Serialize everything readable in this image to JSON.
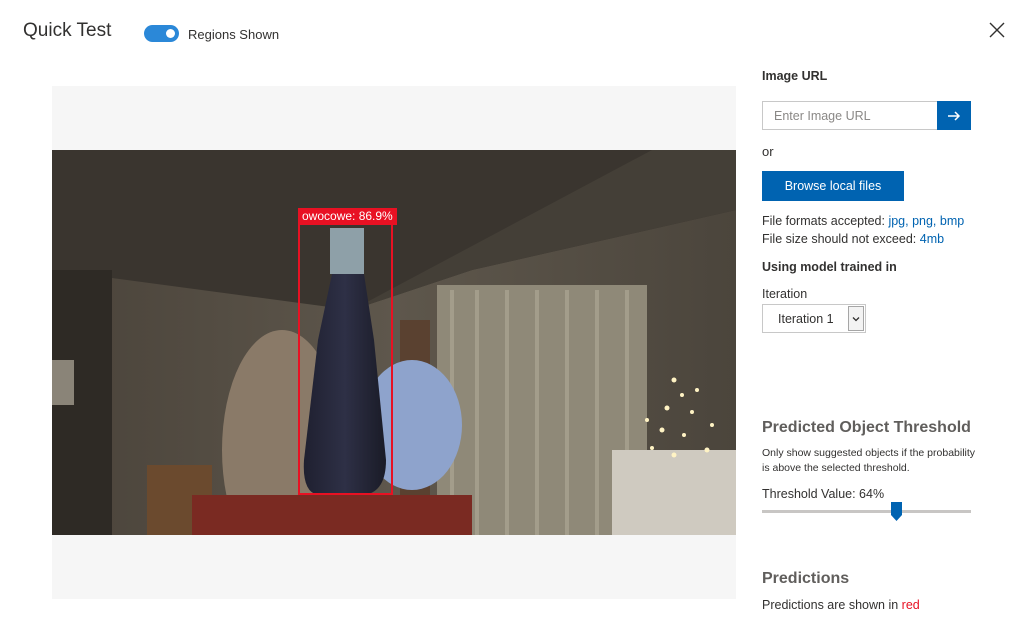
{
  "header": {
    "title": "Quick Test",
    "toggle_label": "Regions Shown",
    "toggle_on": true
  },
  "image": {
    "prediction_label": "owocowe: 86.9%"
  },
  "panel": {
    "image_url_label": "Image URL",
    "url_placeholder": "Enter Image URL",
    "or_text": "or",
    "browse_label": "Browse local files",
    "formats_prefix": "File formats accepted:",
    "formats_value": "jpg, png, bmp",
    "size_prefix": "File size should not exceed:",
    "size_value": "4mb",
    "model_label": "Using model trained in",
    "iteration_label": "Iteration",
    "iteration_value": "Iteration 1",
    "threshold_heading": "Predicted Object Threshold",
    "threshold_desc": "Only show suggested objects if the probability is above the selected threshold.",
    "threshold_text": "Threshold Value: 64%",
    "threshold_percent": 64,
    "predictions_heading": "Predictions",
    "predictions_note_prefix": "Predictions are shown in",
    "predictions_note_color_word": "red"
  },
  "colors": {
    "accent": "#0063b1",
    "toggle": "#2b88d8",
    "prediction": "#e81123"
  },
  "icons": {
    "close": "close-icon",
    "go": "arrow-right-icon",
    "dropdown": "chevron-down-icon"
  }
}
